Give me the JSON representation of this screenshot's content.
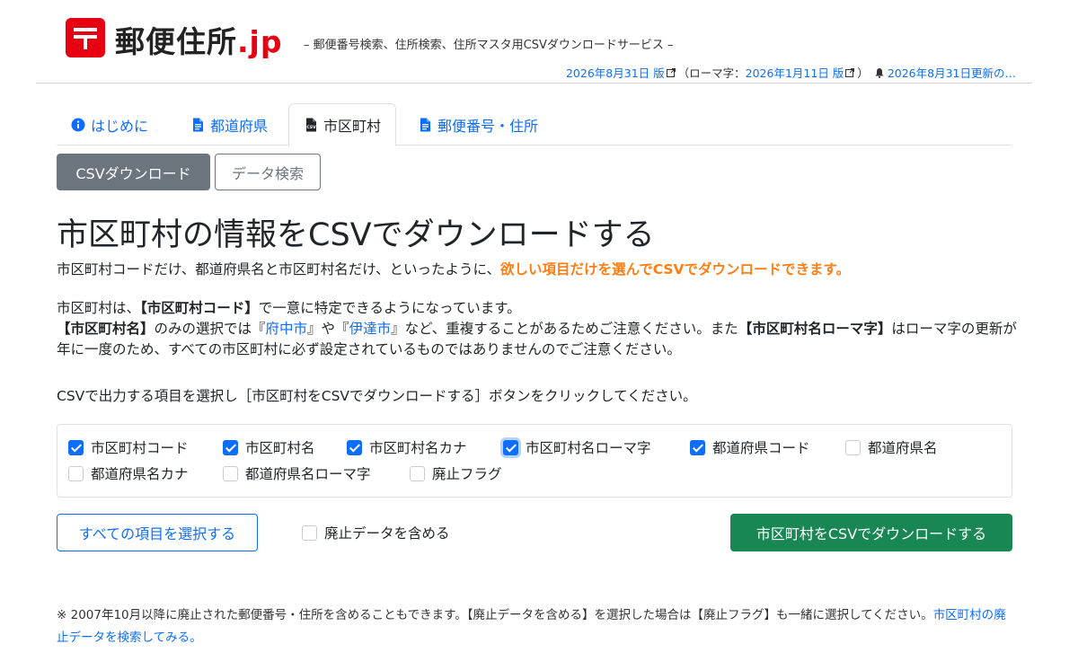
{
  "header": {
    "brand_main": "郵便住所",
    "brand_tld": ".jp",
    "tagline": "– 郵便番号検索、住所検索、住所マスタ用CSVダウンロードサービス –",
    "version_link": "2026年8月31日 版",
    "romaji_prefix": "（ローマ字：",
    "romaji_link": "2026年1月11日 版",
    "romaji_suffix": "）",
    "update_link": "2026年8月31日更新の…"
  },
  "tabs": [
    {
      "label": "はじめに",
      "icon": "info-icon"
    },
    {
      "label": "都道府県",
      "icon": "file-icon"
    },
    {
      "label": "市区町村",
      "icon": "csv-file-icon",
      "active": true
    },
    {
      "label": "郵便番号・住所",
      "icon": "file-icon"
    }
  ],
  "subnav": {
    "csv_download": "CSVダウンロード",
    "data_search": "データ検索"
  },
  "main": {
    "title": "市区町村の情報をCSVでダウンロードする",
    "lead_text": "市区町村コードだけ、都道府県名と市区町村名だけ、といったように、",
    "lead_highlight": "欲しい項目だけを選んでCSVでダウンロードできます。",
    "p1_a": "市区町村は、",
    "p1_b": "【市区町村コード】",
    "p1_c": "で一意に特定できるようになっています。",
    "p2_a": "【市区町村名】",
    "p2_b": "のみの選択では『",
    "p2_link1": "府中市",
    "p2_c": "』や『",
    "p2_link2": "伊達市",
    "p2_d": "』など、重複することがあるためご注意ください。また",
    "p2_e": "【市区町村名ローマ字】",
    "p2_f": "はローマ字の更新が年に一度のため、すべての市区町村に必ず設定されているものではありませんのでご注意ください。",
    "instruction": "CSVで出力する項目を選択し［市区町村をCSVでダウンロードする］ボタンをクリックしてください。"
  },
  "fields": [
    {
      "label": "市区町村コード",
      "checked": true
    },
    {
      "label": "市区町村名",
      "checked": true
    },
    {
      "label": "市区町村名カナ",
      "checked": true
    },
    {
      "label": "市区町村名ローマ字",
      "checked": true
    },
    {
      "label": "都道府県コード",
      "checked": true
    },
    {
      "label": "都道府県名",
      "checked": false
    },
    {
      "label": "都道府県名カナ",
      "checked": false
    },
    {
      "label": "都道府県名ローマ字",
      "checked": false
    },
    {
      "label": "廃止フラグ",
      "checked": false
    }
  ],
  "actions": {
    "select_all": "すべての項目を選択する",
    "include_obsolete": "廃止データを含める",
    "download": "市区町村をCSVでダウンロードする"
  },
  "footnote": {
    "text": "※ 2007年10月以降に廃止された郵便番号・住所を含めることもできます。【廃止データを含める】を選択した場合は【廃止フラグ】も一緒に選択してください。",
    "link": "市区町村の廃止データを検索してみる。"
  },
  "colors": {
    "brand_red": "#e60012",
    "link_blue": "#0d6efd",
    "highlight_orange": "#fd7e14",
    "download_green": "#198754",
    "subnav_gray": "#6c757d"
  }
}
